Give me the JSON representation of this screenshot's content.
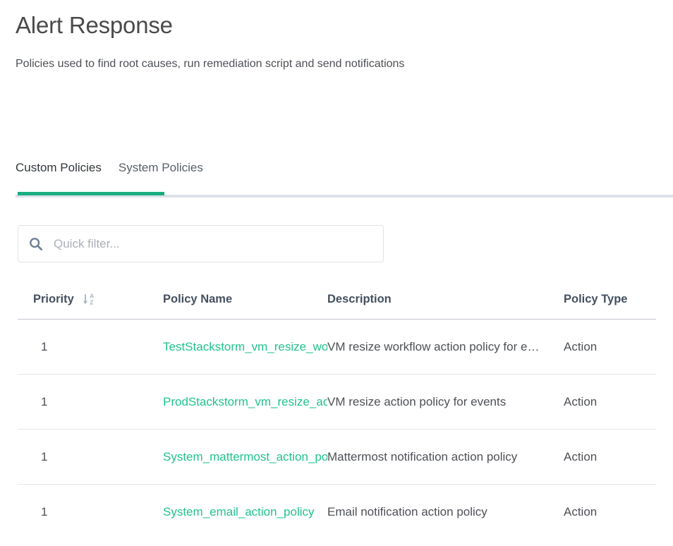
{
  "header": {
    "title": "Alert Response",
    "subtitle": "Policies used to find root causes, run remediation script and send notifications"
  },
  "tabs": [
    {
      "label": "Custom Policies",
      "active": true
    },
    {
      "label": "System Policies",
      "active": false
    }
  ],
  "filter": {
    "placeholder": "Quick filter...",
    "value": "",
    "icon": "search-icon"
  },
  "table": {
    "columns": [
      {
        "key": "priority",
        "label": "Priority",
        "sort_icon": "sort-alpha-descending-icon",
        "sorted": true
      },
      {
        "key": "name",
        "label": "Policy Name",
        "sort_icon": "",
        "sorted": false
      },
      {
        "key": "description",
        "label": "Description",
        "sort_icon": "",
        "sorted": false
      },
      {
        "key": "type",
        "label": "Policy Type",
        "sort_icon": "",
        "sorted": false
      }
    ],
    "rows": [
      {
        "priority": "1",
        "name": "TestStackstorm_vm_resize_workflow_action_policy",
        "description": "VM resize workflow action policy for events",
        "type": "Action"
      },
      {
        "priority": "1",
        "name": "ProdStackstorm_vm_resize_action_policy",
        "description": "VM resize action policy for events",
        "type": "Action"
      },
      {
        "priority": "1",
        "name": "System_mattermost_action_policy",
        "description": "Mattermost notification action policy",
        "type": "Action"
      },
      {
        "priority": "1",
        "name": "System_email_action_policy",
        "description": "Email notification action policy",
        "type": "Action"
      }
    ]
  },
  "colors": {
    "accent_green": "#19ad80",
    "link_green": "#21c28c",
    "tab_track": "#dde1e9",
    "header_text": "#44505f",
    "body_text": "#4d5055"
  }
}
